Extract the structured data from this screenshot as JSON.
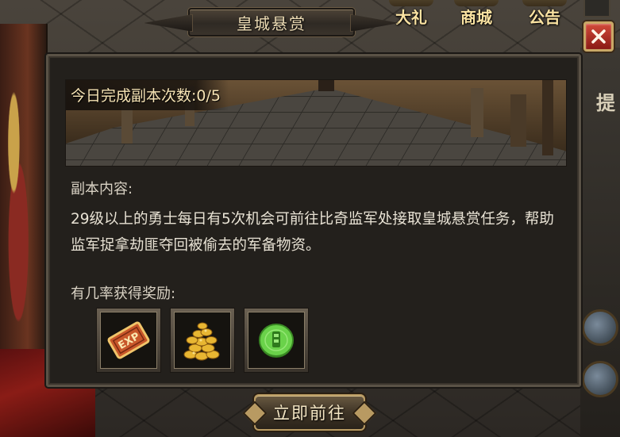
{
  "window": {
    "title": "皇城悬赏"
  },
  "top_bar": {
    "items": [
      {
        "label": "大礼",
        "icon": "gift-badge-icon"
      },
      {
        "label": "商城",
        "icon": "shop-icon"
      },
      {
        "label": "公告",
        "icon": "notice-icon"
      }
    ]
  },
  "side_hint": {
    "text": "提"
  },
  "close_button": {
    "icon": "close-icon"
  },
  "banner": {
    "counter_label": "今日完成副本次数:",
    "counter_value": "0/5"
  },
  "content": {
    "section_title": "副本内容:",
    "description": "29级以上的勇士每日有5次机会可前往比奇监军处接取皇城悬赏任务，帮助监军捉拿劫匪夺回被偷去的军备物资。"
  },
  "rewards": {
    "title": "有几率获得奖励:",
    "items": [
      {
        "icon": "exp-scroll-icon"
      },
      {
        "icon": "gold-coins-icon"
      },
      {
        "icon": "green-token-icon"
      }
    ]
  },
  "action": {
    "go_label": "立即前往"
  },
  "colors": {
    "panel_bg": "#23201c",
    "text": "#e8e2d4",
    "title": "#eddcb5",
    "accent_gold": "#b89a62",
    "close_red": "#c0392b"
  }
}
